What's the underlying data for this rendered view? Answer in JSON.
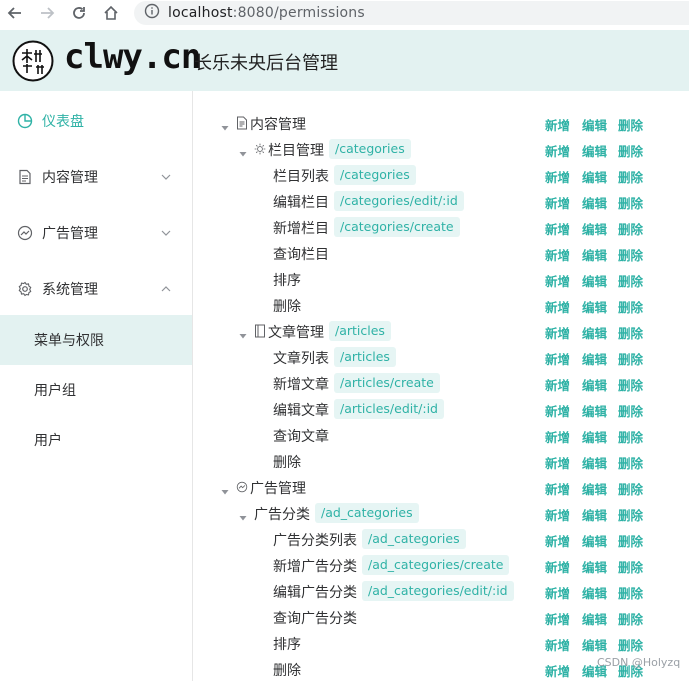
{
  "browser": {
    "url_host": "localhost",
    "url_rest": ":8080/permissions"
  },
  "header": {
    "brand": "clwy.cn",
    "title": "长乐未央后台管理"
  },
  "sidebar": {
    "items": [
      {
        "label": "仪表盘",
        "icon": "pie-chart-icon",
        "active": true
      },
      {
        "label": "内容管理",
        "icon": "document-icon",
        "expanded": false
      },
      {
        "label": "广告管理",
        "icon": "speedometer-icon",
        "expanded": false
      },
      {
        "label": "系统管理",
        "icon": "gear-icon",
        "expanded": true
      }
    ],
    "submenu": [
      {
        "label": "菜单与权限",
        "selected": true
      },
      {
        "label": "用户组",
        "selected": false
      },
      {
        "label": "用户",
        "selected": false
      }
    ]
  },
  "actions": {
    "add": "新增",
    "edit": "编辑",
    "delete": "删除"
  },
  "tree": [
    {
      "level": 0,
      "label": "内容管理",
      "icon": "document-icon",
      "caret": true,
      "route": ""
    },
    {
      "level": 1,
      "label": "栏目管理",
      "icon": "sun-icon",
      "caret": true,
      "route": "/categories"
    },
    {
      "level": 2,
      "label": "栏目列表",
      "route": "/categories"
    },
    {
      "level": 2,
      "label": "编辑栏目",
      "route": "/categories/edit/:id"
    },
    {
      "level": 2,
      "label": "新增栏目",
      "route": "/categories/create"
    },
    {
      "level": 2,
      "label": "查询栏目",
      "route": ""
    },
    {
      "level": 2,
      "label": "排序",
      "route": ""
    },
    {
      "level": 2,
      "label": "删除",
      "route": ""
    },
    {
      "level": 1,
      "label": "文章管理",
      "icon": "book-icon",
      "caret": true,
      "route": "/articles"
    },
    {
      "level": 2,
      "label": "文章列表",
      "route": "/articles"
    },
    {
      "level": 2,
      "label": "新增文章",
      "route": "/articles/create"
    },
    {
      "level": 2,
      "label": "编辑文章",
      "route": "/articles/edit/:id"
    },
    {
      "level": 2,
      "label": "查询文章",
      "route": ""
    },
    {
      "level": 2,
      "label": "删除",
      "route": ""
    },
    {
      "level": 0,
      "label": "广告管理",
      "icon": "speedometer-icon",
      "caret": true,
      "route": ""
    },
    {
      "level": 1,
      "label": "广告分类",
      "caret": true,
      "route": "/ad_categories"
    },
    {
      "level": 2,
      "label": "广告分类列表",
      "route": "/ad_categories"
    },
    {
      "level": 2,
      "label": "新增广告分类",
      "route": "/ad_categories/create"
    },
    {
      "level": 2,
      "label": "编辑广告分类",
      "route": "/ad_categories/edit/:id"
    },
    {
      "level": 2,
      "label": "查询广告分类",
      "route": ""
    },
    {
      "level": 2,
      "label": "排序",
      "route": ""
    },
    {
      "level": 2,
      "label": "删除",
      "route": ""
    }
  ],
  "watermark": "CSDN @Holyzq",
  "colors": {
    "accent": "#2fb2a6",
    "header_bg": "#e3f2f1",
    "tag_bg": "#e6f5f4"
  }
}
